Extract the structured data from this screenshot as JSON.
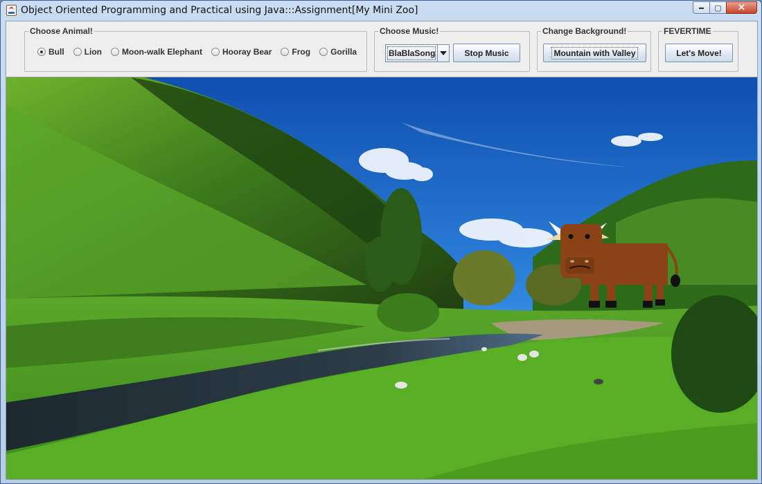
{
  "window": {
    "title": "Object Oriented Programming and Practical using Java:::Assignment[My Mini Zoo]",
    "controls": {
      "minimize": "▬",
      "maximize": "▢",
      "close": "✕"
    }
  },
  "animal_group": {
    "title": "Choose Animal!",
    "options": [
      "Bull",
      "Lion",
      "Moon-walk Elephant",
      "Hooray Bear",
      "Frog",
      "Gorilla"
    ],
    "selected": "Bull"
  },
  "music_group": {
    "title": "Choose Music!",
    "song_select": "BlaBlaSong",
    "stop_label": "Stop Music"
  },
  "background_group": {
    "title": "Change Background!",
    "button_label": "Mountain with Valley"
  },
  "fever_group": {
    "title": "FEVERTIME",
    "button_label": "Let's Move!"
  },
  "scene": {
    "background": "mountain-valley",
    "animal": "bull",
    "colors": {
      "sky": "#1f74d6",
      "grass": "#4fa321",
      "river": "#2a3a46",
      "bull": "#8b4316"
    }
  }
}
